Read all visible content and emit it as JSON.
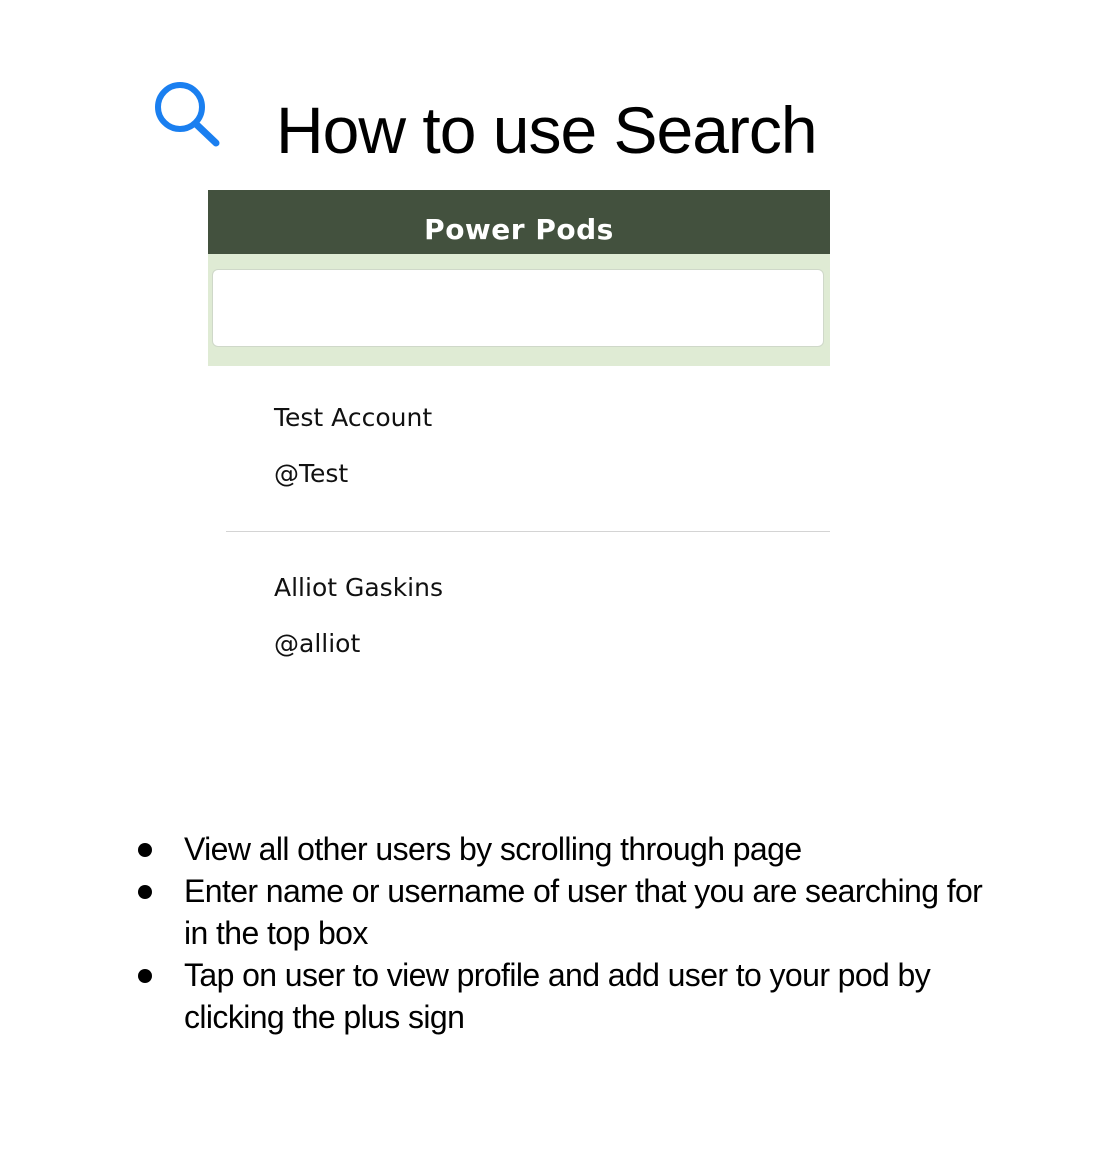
{
  "title": {
    "icon": "search-icon",
    "text": "How to use Search",
    "icon_color": "#1a7ff0"
  },
  "app": {
    "header_title": "Power Pods",
    "header_color": "#43513e",
    "search_bar_color": "#dfebd4",
    "search_value": "",
    "users": [
      {
        "name": "Test Account",
        "handle": "@Test"
      },
      {
        "name": "Alliot Gaskins",
        "handle": "@alliot"
      }
    ]
  },
  "instructions": [
    "View all other users by scrolling through page",
    "Enter name or username of user that you are searching for in the top box",
    "Tap on user to view profile and add user to your pod by clicking the plus sign"
  ]
}
